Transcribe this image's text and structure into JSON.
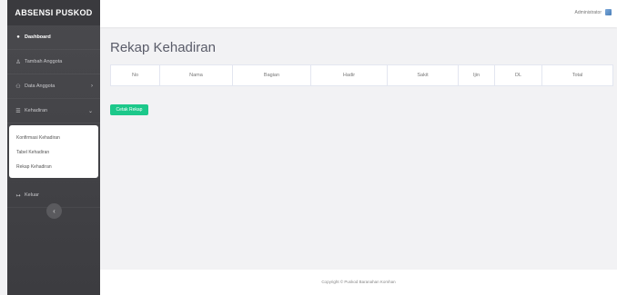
{
  "brand": "ABSENSI PUSKOD",
  "sidebar": {
    "items": [
      {
        "label": "Dashboard",
        "icon": "dashboard-icon"
      },
      {
        "label": "Tambah Anggota",
        "icon": "user-plus-icon"
      },
      {
        "label": "Data Anggota",
        "icon": "users-icon"
      },
      {
        "label": "Kehadiran",
        "icon": "list-icon"
      },
      {
        "label": "Keluar",
        "icon": "logout-icon"
      }
    ],
    "submenu": [
      "Konfirmasi Kehadiran",
      "Tabel Kehadiran",
      "Rekap Kehadiran"
    ]
  },
  "topbar": {
    "user_name": "Administrator"
  },
  "main": {
    "title": "Rekap Kehadiran",
    "table_headers": [
      "No",
      "Nama",
      "Bagian",
      "Hadir",
      "Sakit",
      "Ijin",
      "DL",
      "Total"
    ],
    "print_button": "Cetak Rekap"
  },
  "footer": "Copyright © Puskod Baranahan Komhan",
  "colors": {
    "sidebar": "#3c3c40",
    "accent": "#1cc88a"
  }
}
